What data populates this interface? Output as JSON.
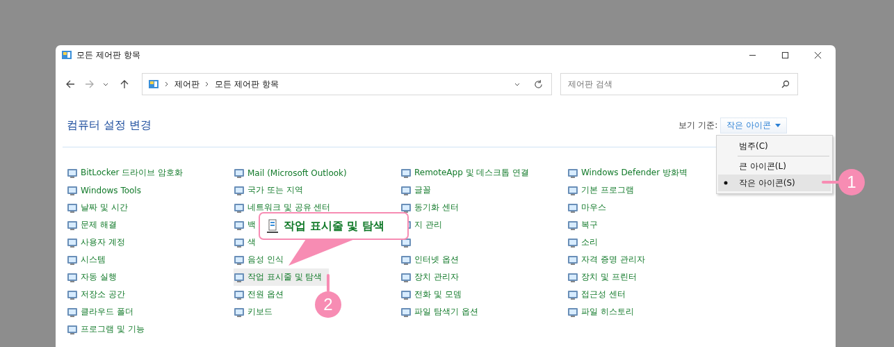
{
  "window": {
    "title": "모든 제어판 항목"
  },
  "address": {
    "path": [
      "제어판",
      "모든 제어판 항목"
    ]
  },
  "search": {
    "placeholder": "제어판 검색"
  },
  "heading": "컴퓨터 설정 변경",
  "view_by": {
    "label": "보기 기준:",
    "value": "작은 아이콘"
  },
  "view_menu": [
    {
      "label": "범주(C)",
      "selected": false
    },
    {
      "label": "큰 아이콘(L)",
      "selected": false
    },
    {
      "label": "작은 아이콘(S)",
      "selected": true
    }
  ],
  "columns": [
    [
      {
        "label": "BitLocker 드라이브 암호화",
        "selected": false
      },
      {
        "label": "Windows Tools",
        "selected": false
      },
      {
        "label": "날짜 및 시간",
        "selected": false
      },
      {
        "label": "문제 해결",
        "selected": false
      },
      {
        "label": "사용자 계정",
        "selected": false
      },
      {
        "label": "시스템",
        "selected": false
      },
      {
        "label": "자동 실행",
        "selected": false
      },
      {
        "label": "저장소 공간",
        "selected": false
      },
      {
        "label": "클라우드 폴더",
        "selected": false
      },
      {
        "label": "프로그램 및 기능",
        "selected": false
      }
    ],
    [
      {
        "label": "Mail (Microsoft Outlook)",
        "selected": false
      },
      {
        "label": "국가 또는 지역",
        "selected": false
      },
      {
        "label": "네트워크 및 공유 센터",
        "selected": false
      },
      {
        "label": "백",
        "selected": false
      },
      {
        "label": "색",
        "selected": false
      },
      {
        "label": "음성 인식",
        "selected": false
      },
      {
        "label": "작업 표시줄 및 탐색",
        "selected": true
      },
      {
        "label": "전원 옵션",
        "selected": false
      },
      {
        "label": "키보드",
        "selected": false
      }
    ],
    [
      {
        "label": "RemoteApp 및 데스크톱 연결",
        "selected": false
      },
      {
        "label": "글꼴",
        "selected": false
      },
      {
        "label": "동기화 센터",
        "selected": false
      },
      {
        "label": "지 관리",
        "selected": false
      },
      {
        "selected": false
      },
      {
        "label": "인터넷 옵션",
        "selected": false
      },
      {
        "label": "장치 관리자",
        "selected": false
      },
      {
        "label": "전화 및 모뎀",
        "selected": false
      },
      {
        "label": "파일 탐색기 옵션",
        "selected": false
      }
    ],
    [
      {
        "label": "Windows Defender 방화벽",
        "selected": false
      },
      {
        "label": "기본 프로그램",
        "selected": false
      },
      {
        "label": "마우스",
        "selected": false
      },
      {
        "label": "복구",
        "selected": false
      },
      {
        "label": "소리",
        "selected": false
      },
      {
        "label": "자격 증명 관리자",
        "selected": false
      },
      {
        "label": "장치 및 프린터",
        "selected": false
      },
      {
        "label": "접근성 센터",
        "selected": false
      },
      {
        "label": "파일 히스토리",
        "selected": false
      }
    ]
  ],
  "callout": {
    "label": "작업 표시줄 및 탐색"
  },
  "badges": [
    "1",
    "2"
  ]
}
